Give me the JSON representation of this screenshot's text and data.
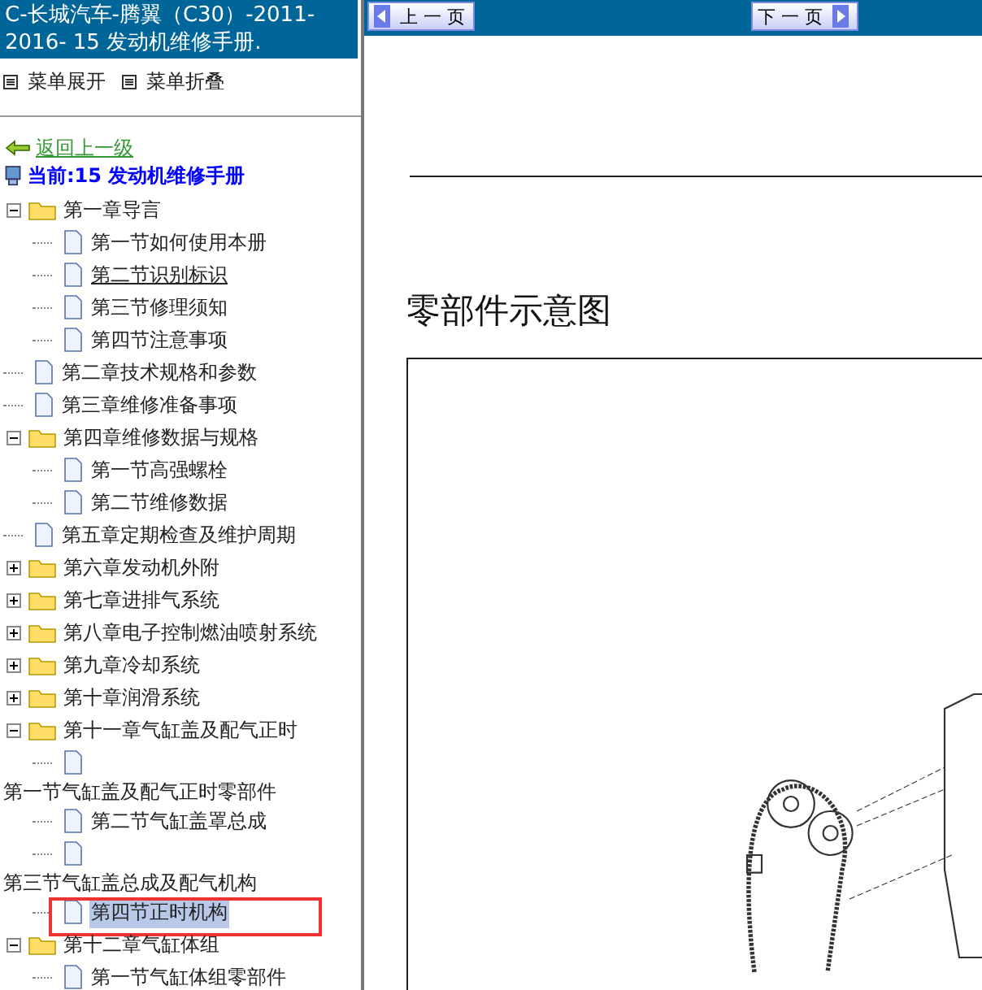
{
  "sidebar": {
    "title": "C-长城汽车-腾翼（C30）-2011-2016- 15 发动机维修手册.",
    "menu_actions": [
      {
        "label": "菜单展开"
      },
      {
        "label": "菜单折叠"
      }
    ],
    "back_link": "返回上一级",
    "current": "当前:15 发动机维修手册",
    "tree": [
      {
        "kind": "folder",
        "label": "第一章导言",
        "expanded": true,
        "children": [
          {
            "kind": "page",
            "label": "第一节如何使用本册",
            "selected": false,
            "hovered": false
          },
          {
            "kind": "page",
            "label": "第二节识别标识",
            "selected": false,
            "hovered": true
          },
          {
            "kind": "page",
            "label": "第三节修理须知",
            "selected": false,
            "hovered": false
          },
          {
            "kind": "page",
            "label": "第四节注意事项",
            "selected": false,
            "hovered": false
          }
        ]
      },
      {
        "kind": "page",
        "label": "第二章技术规格和参数",
        "selected": false,
        "hovered": false
      },
      {
        "kind": "page",
        "label": "第三章维修准备事项",
        "selected": false,
        "hovered": false
      },
      {
        "kind": "folder",
        "label": "第四章维修数据与规格",
        "expanded": true,
        "children": [
          {
            "kind": "page",
            "label": "第一节高强螺栓",
            "selected": false,
            "hovered": false
          },
          {
            "kind": "page",
            "label": "第二节维修数据",
            "selected": false,
            "hovered": false
          }
        ]
      },
      {
        "kind": "page",
        "label": "第五章定期检查及维护周期",
        "selected": false,
        "hovered": false
      },
      {
        "kind": "folder",
        "label": "第六章发动机外附",
        "expanded": false
      },
      {
        "kind": "folder",
        "label": "第七章进排气系统",
        "expanded": false
      },
      {
        "kind": "folder",
        "label": "第八章电子控制燃油喷射系统",
        "expanded": false
      },
      {
        "kind": "folder",
        "label": "第九章冷却系统",
        "expanded": false
      },
      {
        "kind": "folder",
        "label": "第十章润滑系统",
        "expanded": false
      },
      {
        "kind": "folder",
        "label": "第十一章气缸盖及配气正时",
        "expanded": true,
        "children": [
          {
            "kind": "wrapped-page",
            "label": "第一节气缸盖及配气正时零部件",
            "selected": false,
            "hovered": false
          },
          {
            "kind": "page",
            "label": "第二节气缸盖罩总成",
            "selected": false,
            "hovered": false
          },
          {
            "kind": "wrapped-page",
            "label": "第三节气缸盖总成及配气机构",
            "selected": false,
            "hovered": false
          },
          {
            "kind": "page",
            "label": "第四节正时机构",
            "selected": true,
            "hovered": false
          }
        ]
      },
      {
        "kind": "folder",
        "label": "第十二章气缸体组",
        "expanded": true,
        "children": [
          {
            "kind": "page",
            "label": "第一节气缸体组零部件",
            "selected": false,
            "hovered": false
          }
        ]
      }
    ]
  },
  "toolbar": {
    "prev": "上 一 页",
    "next": "下 一 页"
  },
  "document": {
    "heading": "零部件示意图"
  }
}
